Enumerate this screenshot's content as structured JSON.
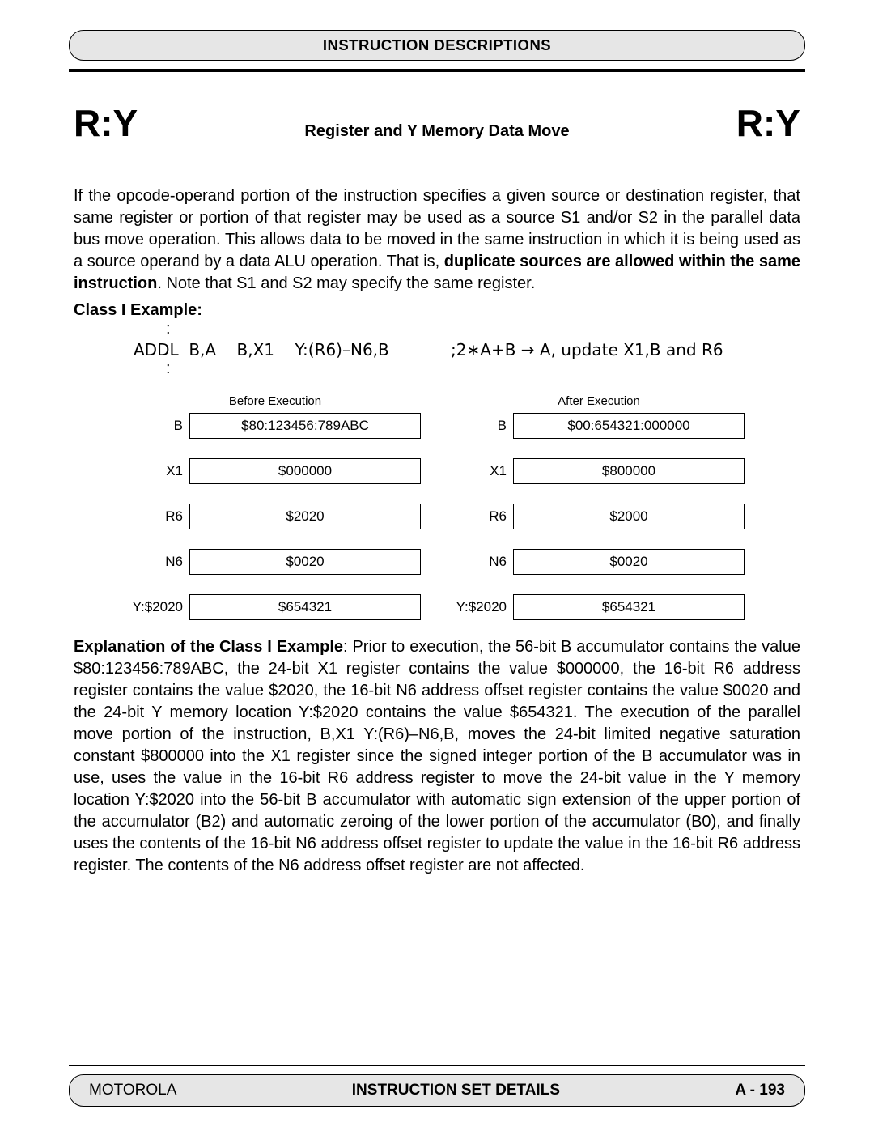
{
  "header": {
    "title": "INSTRUCTION DESCRIPTIONS"
  },
  "titleRow": {
    "left": "R:Y",
    "subtitle": "Register and Y Memory Data Move",
    "right": "R:Y"
  },
  "para1_a": "If the opcode-operand portion of the instruction specifies a given source or destination register, that same register or portion of that register may be used as a source S1 and/or S2 in the parallel data bus move operation. This allows data to be moved in the same instruction in which it is being used as a source operand by a data ALU operation. That is, ",
  "para1_bold": "duplicate sources are allowed within the same instruction",
  "para1_b": ". Note that S1 and S2 may specify the same register.",
  "classHead": "Class I Example:",
  "colon": ":",
  "codeLine": "ADDL  B,A    B,X1    Y:(R6)–N6,B            ;2∗A+B → A, update X1,B and R6",
  "cols": {
    "beforeHead": "Before Execution",
    "afterHead": "After Execution"
  },
  "regs": {
    "before": [
      {
        "label": "B",
        "value": "$80:123456:789ABC"
      },
      {
        "label": "X1",
        "value": "$000000"
      },
      {
        "label": "R6",
        "value": "$2020"
      },
      {
        "label": "N6",
        "value": "$0020"
      },
      {
        "label": "Y:$2020",
        "value": "$654321"
      }
    ],
    "after": [
      {
        "label": "B",
        "value": "$00:654321:000000"
      },
      {
        "label": "X1",
        "value": "$800000"
      },
      {
        "label": "R6",
        "value": "$2000"
      },
      {
        "label": "N6",
        "value": "$0020"
      },
      {
        "label": "Y:$2020",
        "value": "$654321"
      }
    ]
  },
  "explainHead": "Explanation of the Class I Example",
  "explainBody": ": Prior to execution, the 56-bit B accumulator contains the value $80:123456:789ABC, the 24-bit X1 register contains the value $000000, the 16-bit R6 address register contains the value $2020, the 16-bit N6 address offset register contains the value $0020 and the 24-bit Y memory location Y:$2020 contains the value $654321. The execution of the parallel move portion of the instruction, B,X1 Y:(R6)–N6,B, moves the 24-bit limited negative saturation constant $800000 into the X1 register since the signed integer portion of the B accumulator was in use, uses the value in the 16-bit R6 address register to move the 24-bit value in the Y memory location Y:$2020 into the 56-bit B accumulator with automatic sign extension of the upper portion of the accumulator (B2) and automatic zeroing of the lower portion of the accumulator (B0), and finally uses the contents of the 16-bit N6 address offset register to update the value in the 16-bit R6 address register. The contents of the N6 address offset register are not affected.",
  "footer": {
    "left": "MOTOROLA",
    "mid": "INSTRUCTION SET DETAILS",
    "right": "A - 193"
  }
}
